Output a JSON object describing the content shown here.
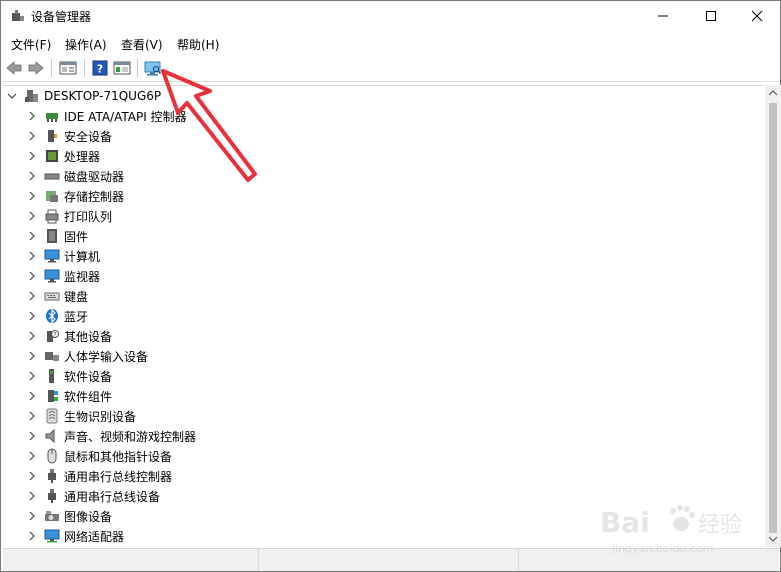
{
  "window": {
    "title": "设备管理器",
    "controls": {
      "minimize": "—",
      "maximize": "☐",
      "close": "✕"
    }
  },
  "menubar": {
    "items": [
      "文件(F)",
      "操作(A)",
      "查看(V)",
      "帮助(H)"
    ]
  },
  "toolbar": {
    "buttons": [
      "back-icon",
      "forward-icon",
      "properties-icon",
      "help-icon",
      "show-hide-icon",
      "scan-hardware-icon"
    ]
  },
  "tree": {
    "root": "DESKTOP-71QUG6P",
    "items": [
      "IDE ATA/ATAPI 控制器",
      "安全设备",
      "处理器",
      "磁盘驱动器",
      "存储控制器",
      "打印队列",
      "固件",
      "计算机",
      "监视器",
      "键盘",
      "蓝牙",
      "其他设备",
      "人体学输入设备",
      "软件设备",
      "软件组件",
      "生物识别设备",
      "声音、视频和游戏控制器",
      "鼠标和其他指针设备",
      "通用串行总线控制器",
      "通用串行总线设备",
      "图像设备",
      "网络适配器"
    ]
  },
  "watermark": {
    "brand": "Bai",
    "brand_cn": "经验",
    "url": "jingyan.baidu.com"
  },
  "colors": {
    "accent_arrow": "#e8313a",
    "toolbar_help": "#2457b6",
    "monitor": "#3a8fd6"
  }
}
